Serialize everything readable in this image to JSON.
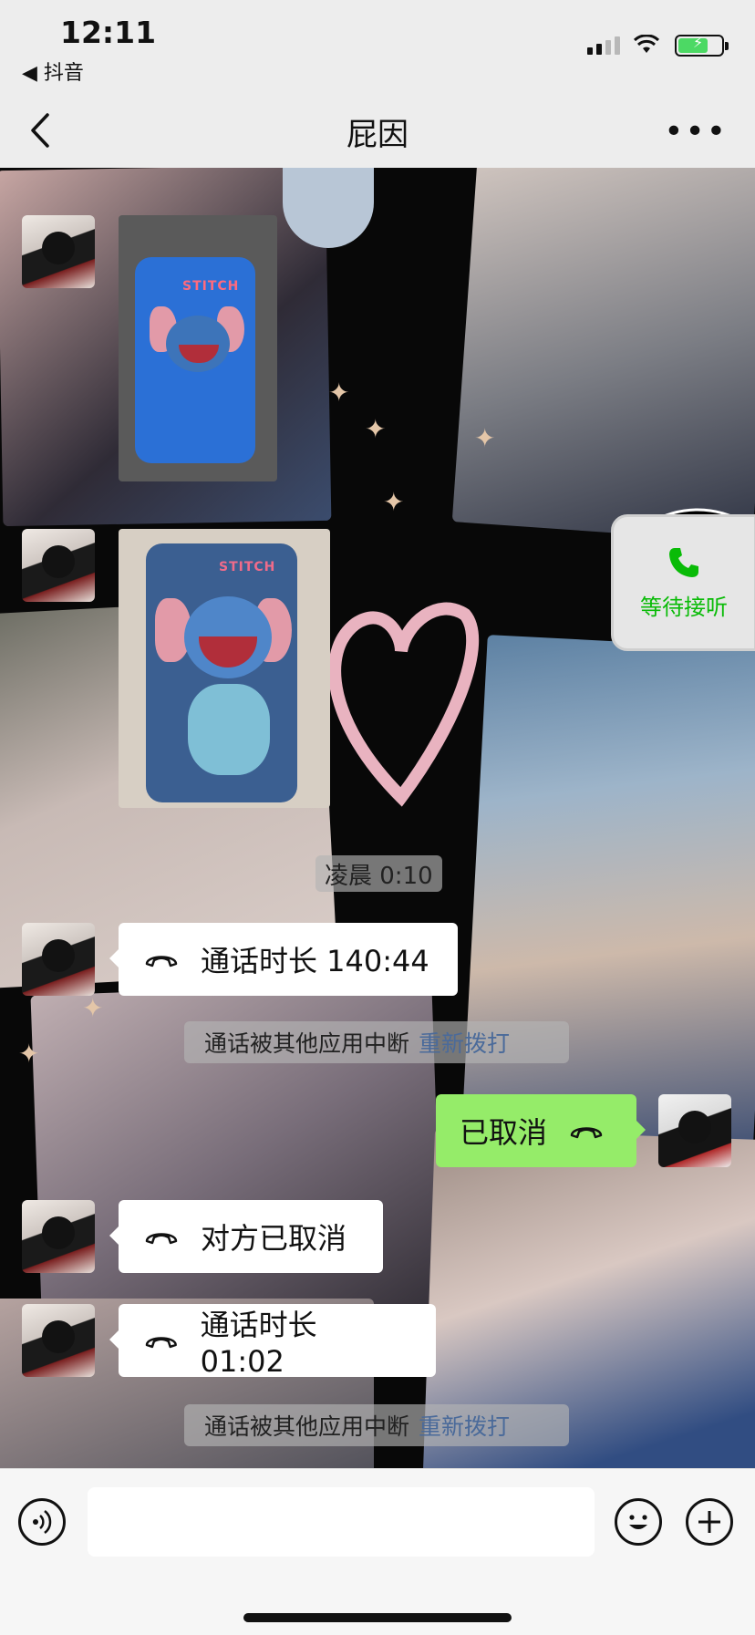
{
  "status_bar": {
    "time": "12:11",
    "back_app": "◀ 抖音"
  },
  "nav": {
    "title": "屁因"
  },
  "call_widget": {
    "label": "等待接听"
  },
  "messages": {
    "timestamp": "凌晨 0:10",
    "call_duration_1": "通话时长 140:44",
    "interrupted_1": "通话被其他应用中断",
    "redial_1": "重新拨打",
    "cancelled": "已取消",
    "other_cancelled": "对方已取消",
    "call_duration_2": "通话时长 01:02",
    "interrupted_2": "通话被其他应用中断",
    "redial_2": "重新拨打"
  },
  "images": {
    "case_label_1": "STITCH",
    "case_label_2": "STITCH"
  },
  "colors": {
    "self_bubble": "#95ec69",
    "other_bubble": "#ffffff",
    "accent_green": "#09bb07",
    "link_blue": "#4a6a9a"
  }
}
